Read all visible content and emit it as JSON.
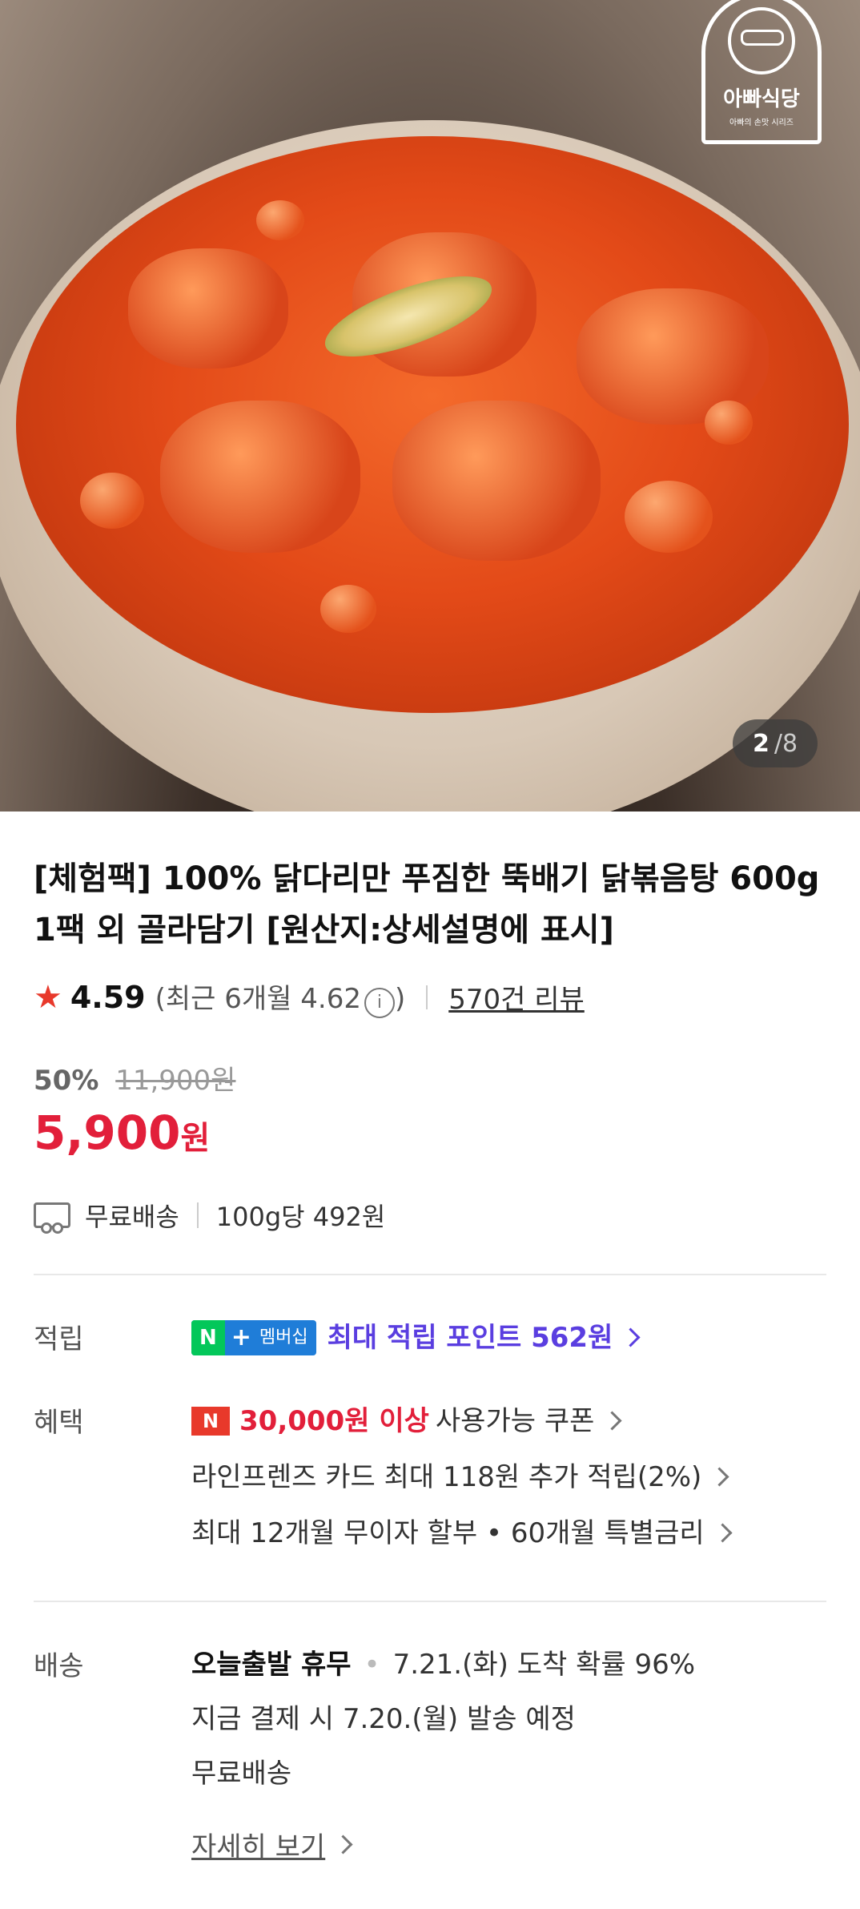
{
  "hero": {
    "logo_text": "아빠식당",
    "logo_subtext": "아빠의 손맛 시리즈",
    "counter_current": "2",
    "counter_sep": "/",
    "counter_total": "8"
  },
  "product": {
    "title": "[체험팩] 100% 닭다리만 푸짐한 뚝배기 닭볶음탕 600g 1팩 외 골라담기 [원산지:상세설명에 표시]",
    "rating": "4.59",
    "recent_rating": "(최근 6개월 4.62",
    "recent_close": ")",
    "review_count": "570건 리뷰",
    "discount": "50%",
    "original_price": "11,900원",
    "final_price": "5,900",
    "currency": "원",
    "free_shipping": "무료배송",
    "unit_price": "100g당 492원"
  },
  "points": {
    "label": "적립",
    "badge_n": "N",
    "badge_plus": "+",
    "badge_member": "멤버십",
    "text": "최대 적립 포인트 562원"
  },
  "benefits": {
    "label": "혜택",
    "badge": "N",
    "coupon_amount": "30,000원 이상",
    "coupon_text": "사용가능 쿠폰",
    "card": "라인프렌즈 카드 최대 118원 추가 적립(2%)",
    "installment": "최대 12개월 무이자 할부 • 60개월 특별금리"
  },
  "delivery": {
    "label": "배송",
    "status": "오늘출발 휴무",
    "arrival": "7.21.(화) 도착 확률 96%",
    "ship_date": "지금 결제 시 7.20.(월) 발송 예정",
    "fee": "무료배송",
    "detail_link": "자세히 보기"
  },
  "colors": {
    "price_red": "#e21f3a",
    "star_red": "#e8392b",
    "points_purple": "#5a3ee0",
    "naver_green": "#03c75a"
  }
}
